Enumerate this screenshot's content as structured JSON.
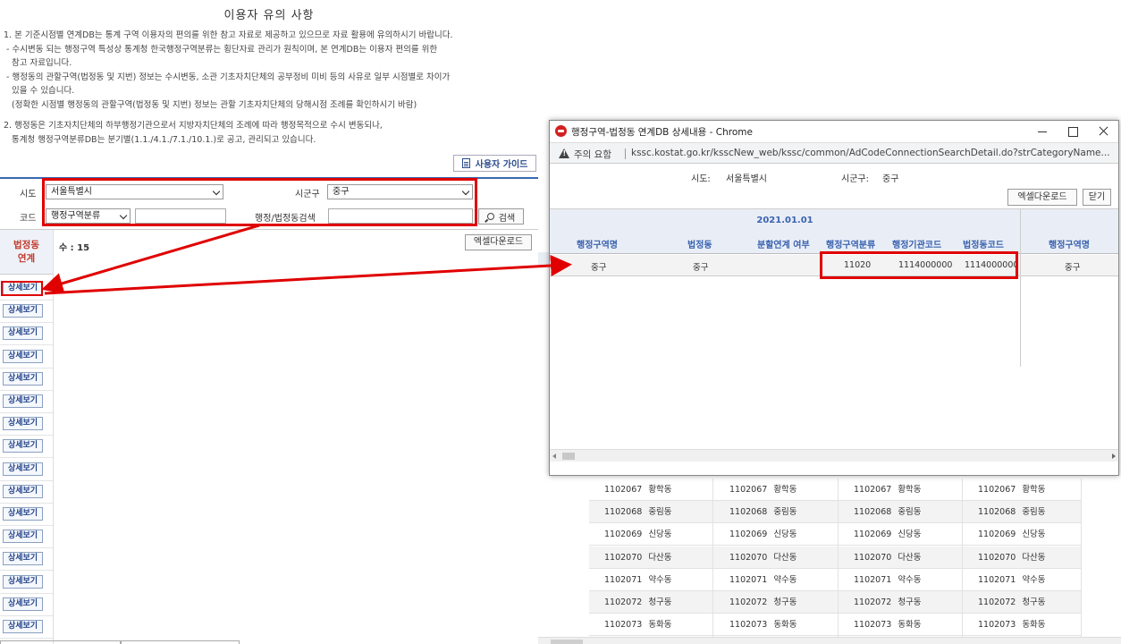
{
  "notice": {
    "title": "이용자 유의 사항",
    "lines": [
      "1. 본 기준시점별 연계DB는 통계 구역 이용자의 편의를 위한 참고 자료로 제공하고 있으므로 자료 활용에 유의하시기 바랍니다.",
      " - 수시변동 되는 행정구역 특성상 통계청 한국행정구역분류는 횡단자료 관리가 원칙이며, 본 연계DB는 이용자 편의를 위한",
      "   참고 자료입니다.",
      " - 행정동의 관할구역(법정동 및 지번) 정보는 수시변동, 소관 기초자치단체의 공부정비 미비 등의 사유로 일부 시점별로 차이가",
      "   있을 수 있습니다.",
      "   (정확한 시점별 행정동의 관할구역(법정동 및 지번) 정보는 관할 기초자치단체의 당해시점 조례를 확인하시기 바람)",
      "2. 행정동은 기초자치단체의 하부행정기관으로서 지방자치단체의 조례에 따라 행정목적으로 수시 변동되나,",
      "   통계청 행정구역분류DB는 분기별(1.1./4.1./7.1./10.1.)로 공고, 관리되고 있습니다."
    ]
  },
  "guide_button": "사용자 가이드",
  "filters": {
    "sido_label": "시도",
    "sido_value": "서울특별시",
    "sigungu_label": "시군구",
    "sigungu_value": "중구",
    "code_label": "코드",
    "code_value": "행정구역분류",
    "search_label": "행정/법정동검색",
    "search_button": "검색"
  },
  "left_table": {
    "side_header": [
      "법정동",
      "연계"
    ],
    "count_text": "수 : 15",
    "excel_button": "엑셀다운로드",
    "detail_button": "상세보기",
    "detail_count": 16
  },
  "bg_table": {
    "rows": [
      [
        "1102067",
        "황학동"
      ],
      [
        "1102068",
        "중림동"
      ],
      [
        "1102069",
        "신당동"
      ],
      [
        "1102070",
        "다산동"
      ],
      [
        "1102071",
        "약수동"
      ],
      [
        "1102072",
        "청구동"
      ],
      [
        "1102073",
        "동화동"
      ]
    ]
  },
  "popup": {
    "window_title": "행정구역-법정동 연계DB 상세내용 - Chrome",
    "warning": "주의 요함",
    "url": "kssc.kostat.go.kr/ksscNew_web/kssc/common/AdCodeConnectionSearchDetail.do?strCategoryName...",
    "sido_label": "시도:",
    "sido_value": "서울특별시",
    "sigungu_label": "시군구:",
    "sigungu_value": "중구",
    "excel_button": "엑셀다운로드",
    "close_button": "닫기",
    "date_header": "2021.01.01",
    "columns": [
      "행정구역명",
      "법정동",
      "분할연계 여부",
      "행정구역분류",
      "행정기관코드",
      "법정동코드",
      "행정구역명"
    ],
    "row": [
      "중구",
      "중구",
      "",
      "11020",
      "1114000000",
      "1114000000",
      "중구"
    ]
  }
}
